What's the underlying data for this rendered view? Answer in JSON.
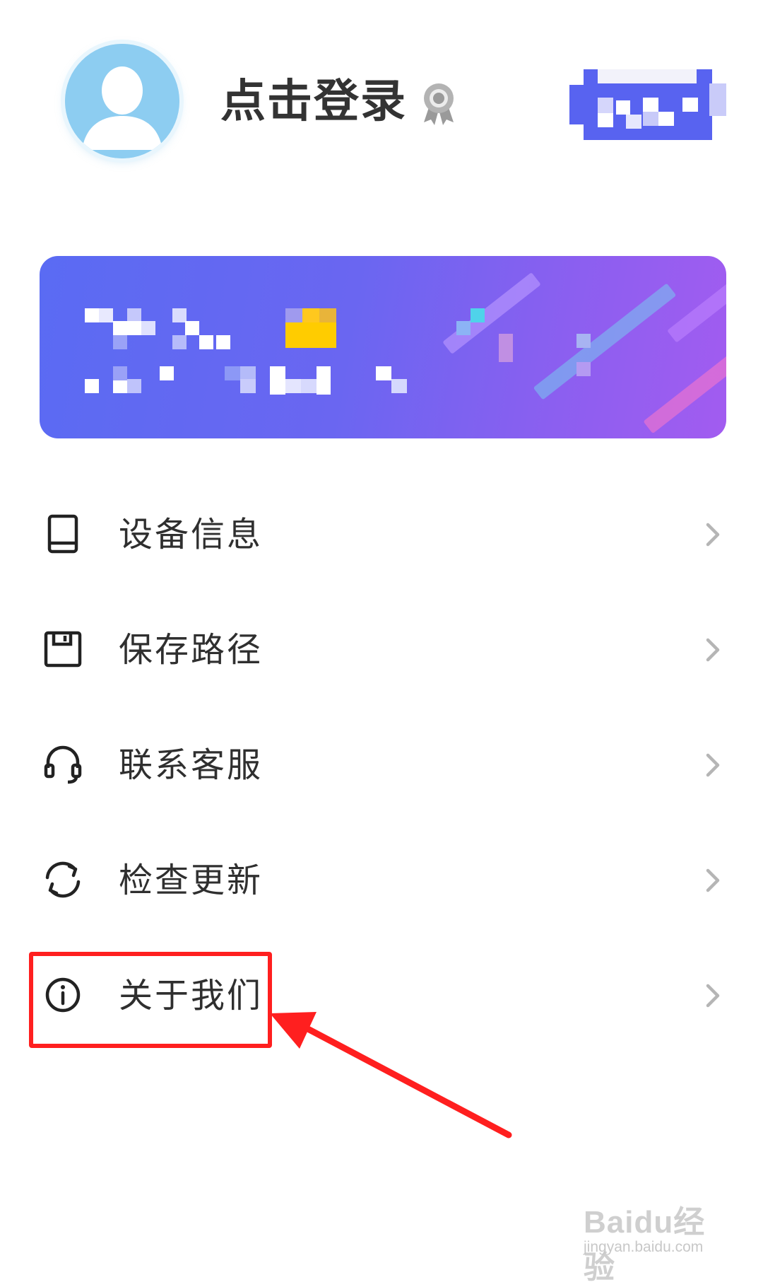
{
  "header": {
    "login_text": "点击登录",
    "avatar_icon": "default-user-avatar-icon",
    "badge_icon": "award-badge-icon"
  },
  "promo_banner": {
    "content": "pixelated (obscured)"
  },
  "menu": {
    "items": [
      {
        "label": "设备信息",
        "icon": "phone-device-icon"
      },
      {
        "label": "保存路径",
        "icon": "floppy-save-icon"
      },
      {
        "label": "联系客服",
        "icon": "headset-icon"
      },
      {
        "label": "检查更新",
        "icon": "refresh-icon"
      },
      {
        "label": "关于我们",
        "icon": "info-icon"
      }
    ]
  },
  "annotation": {
    "highlight_color": "#ff1f1f",
    "highlighted_item": "关于我们"
  },
  "watermark": {
    "brand": "Baidu经验",
    "url": "jingyan.baidu.com"
  },
  "colors": {
    "banner_start": "#5a6bf3",
    "banner_end": "#a25cf0",
    "text": "#333333",
    "chevron": "#b5b5b5"
  }
}
